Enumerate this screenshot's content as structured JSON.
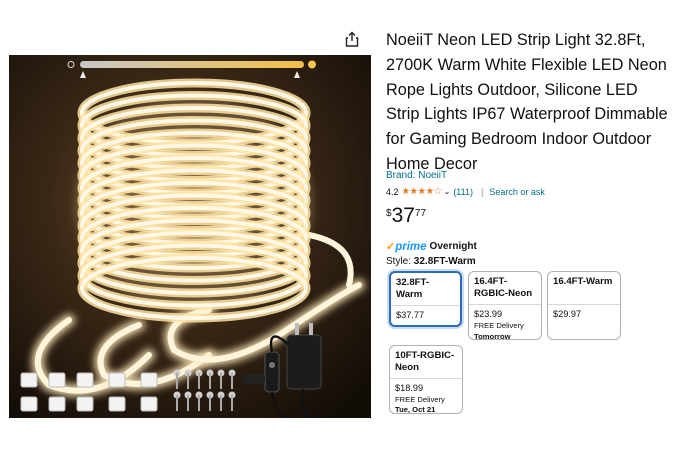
{
  "product": {
    "title": "NoeiiT Neon LED Strip Light 32.8Ft, 2700K Warm White Flexible LED Neon Rope Lights Outdoor, Silicone LED Strip Lights IP67 Waterproof Dimmable for Gaming Bedroom Indoor Outdoor Home Decor",
    "brand": "Brand: NoeiiT",
    "rating": "4.2",
    "stars_glyphs": "★★★★☆",
    "review_count": "(111)",
    "search_link": "Search or ask",
    "price": {
      "symbol": "$",
      "whole": "37",
      "fraction": "77"
    },
    "prime_check": "✓",
    "prime_label": "prime",
    "delivery_speed": "Overnight",
    "style_label": "Style:",
    "style_value": "32.8FT-Warm"
  },
  "image": {
    "brightness_min": "0%",
    "brightness_max": "100%"
  },
  "options": [
    {
      "name": "32.8FT-Warm",
      "price": "$37.77",
      "delivery": "",
      "delivery_date": "",
      "selected": true
    },
    {
      "name": "16.4FT-RGBIC-Neon",
      "price": "$23.99",
      "delivery": "FREE Delivery",
      "delivery_date": "Tomorrow",
      "selected": false
    },
    {
      "name": "16.4FT-Warm",
      "price": "$29.97",
      "delivery": "",
      "delivery_date": "",
      "selected": false
    },
    {
      "name": "10FT-RGBIC-Neon",
      "price": "$18.99",
      "delivery": "FREE Delivery",
      "delivery_date": "Tue, Oct 21",
      "selected": false
    }
  ],
  "colors": {
    "link": "#007185",
    "star": "#de7921",
    "prime_blue": "#1a98ff",
    "selected_border": "#2e6bb8"
  },
  "icons": {
    "share": "share-icon"
  }
}
